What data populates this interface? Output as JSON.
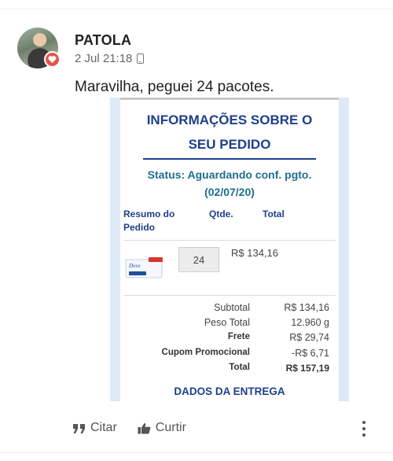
{
  "post": {
    "author": "PATOLA",
    "timestamp": "2 Jul 21:18",
    "text": "Maravilha, peguei 24 pacotes."
  },
  "order_screenshot": {
    "title_line1": "INFORMAÇÕES SOBRE O",
    "title_line2": "SEU PEDIDO",
    "status_line1": "Status: Aguardando conf. pgto.",
    "status_line2": "(02/07/20)",
    "columns": {
      "resumo": "Resumo do Pedido",
      "qtde": "Qtde.",
      "total": "Total"
    },
    "item": {
      "product_brand": "Dove",
      "quantity": "24",
      "total": "R$ 134,16"
    },
    "summary": [
      {
        "label": "Subtotal",
        "value": "R$ 134,16"
      },
      {
        "label": "Peso Total",
        "value": "12.960 g"
      },
      {
        "label": "Frete",
        "value": "R$ 29,74"
      },
      {
        "label": "Cupom Promocional",
        "value": "-R$ 6,71"
      },
      {
        "label": "Total",
        "value": "R$ 157,19"
      }
    ],
    "delivery_heading": "DADOS DA ENTREGA"
  },
  "actions": {
    "quote_label": "Citar",
    "like_label": "Curtir"
  },
  "icons": {
    "badge": "heart-icon",
    "device": "mobile-phone-icon",
    "quote": "quote-icon",
    "like": "thumbs-up-icon",
    "more": "more-vertical-icon"
  },
  "colors": {
    "heading_blue": "#1d3f8c",
    "status_teal": "#1f6e8e",
    "badge_red": "#e4554d",
    "frame_blue": "#dde9f6"
  }
}
